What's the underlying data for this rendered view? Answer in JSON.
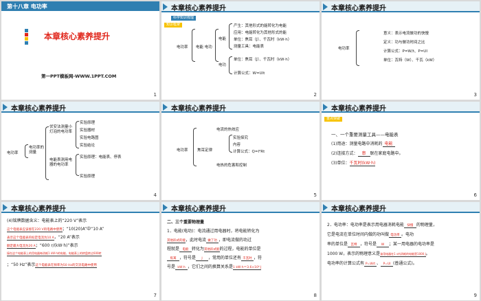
{
  "slides": [
    {
      "num": "1",
      "chapter": "第十八章   电功率",
      "title": "本章核心素养提升",
      "footer": "第一PPT模板网-WWW.1PPT.COM"
    },
    {
      "num": "2",
      "header": "本章核心素养提升",
      "tag1": "科学知识梳理",
      "tag2": "知识框架",
      "root": "电功率",
      "b1": "电能  电功",
      "b1a": "电能",
      "b1b": "电功",
      "items": [
        "产生：其他形式的能转化为电能",
        "应用：电能转化为其他形式的能",
        "单位：焦耳（J）、千瓦时（kW·h）",
        "测量工具：电能表",
        "单位：焦耳（J）、千瓦时（kW·h）",
        "计算公式：W=UIt"
      ]
    },
    {
      "num": "3",
      "header": "本章核心素养提升",
      "root": "电功率",
      "items": [
        "意义：表示电流做功的快慢",
        "定义：功与做功时间之比",
        "计算公式：P=W/t、P=UI",
        "单位：瓦特（W）、千瓦（kW）"
      ]
    },
    {
      "num": "4",
      "header": "本章核心素养提升",
      "root": "电功率",
      "mid": "电功率的测量",
      "g1": "伏安法测量小灯泡的电功率",
      "g2": "电能表测用电器的电功率",
      "items": [
        "实验原理",
        "实验器材",
        "实验电路图",
        "实验结论",
        "实验原理：电能表、停表",
        "实验原理"
      ]
    },
    {
      "num": "5",
      "header": "本章核心素养提升",
      "root": "电功率",
      "mid": "焦耳定律",
      "items": [
        "电流的热效应",
        "实验探究",
        "内容",
        "计算公式：Q=I²Rt",
        "电热的危害和控制"
      ]
    },
    {
      "num": "6",
      "header": "本章核心素养提升",
      "tag": "重点突破",
      "l1": "一、一个重要测量工具——电能表",
      "l2": "(1)用途：测量电路中消耗的",
      "a2": "电能",
      "l3": "(2)连接方式：",
      "a3": "串",
      "l3b": "联在家庭电路中。",
      "l4": "(3)单位：",
      "a4": "千瓦时(kW·h)"
    },
    {
      "num": "7",
      "header": "本章核心素养提升",
      "lines": [
        "(4)铭牌数据含义：电能表上的“220 V”表示",
        "这个电能表应该接在220 V的电路中使用",
        "；“10(20)A”中“10 A”",
        "表示这个电能表的标定电流为10 A",
        "，“20 A”表示",
        "额定最大电流为20 A",
        "；“600 r/(kW·h)”表示",
        "接在这个电能表上的用电器每消耗1 kW·h的电能，电能表上的转盘转过600转",
        "；“50 Hz”表示",
        "这个电能表在频率为50 Hz的交流电路中使用"
      ]
    },
    {
      "num": "8",
      "header": "本章核心素养提升",
      "lines": [
        "二、三个重要物理量",
        "1．电能(电功)：电流通过用电器时，将电能转化为",
        "其他形式的能",
        "，此时电流",
        "做了功",
        "，即电流做的功过",
        "程就是",
        "电能",
        "转化为",
        "其他形式能",
        "的过程，电能的单位是",
        "焦耳",
        "，符号是",
        "J",
        "，常用的单位还有",
        "千瓦时",
        "，符",
        "号是",
        "kW·h",
        "，它们之间的换算关系是",
        "1 kW·h＝3.6×10⁶ J"
      ]
    },
    {
      "num": "9",
      "header": "本章核心素养提升",
      "lines": [
        "2．电功率：电功率是表示用电器消耗电能",
        "快慢",
        "的物理量，",
        "它是电流在单位时间内做的功叫做",
        "电功率",
        "。电功",
        "率的单位是",
        "瓦特",
        "，符号是",
        "W",
        "；某一用电器的电功率是",
        "1000 W，表示的物理意义是",
        "该用电器在1 s内消耗的电能是1000 J",
        "。",
        "电功率的计算公式有",
        "P=W/t",
        "、",
        "P=UI",
        "(普通公式)。"
      ]
    }
  ]
}
